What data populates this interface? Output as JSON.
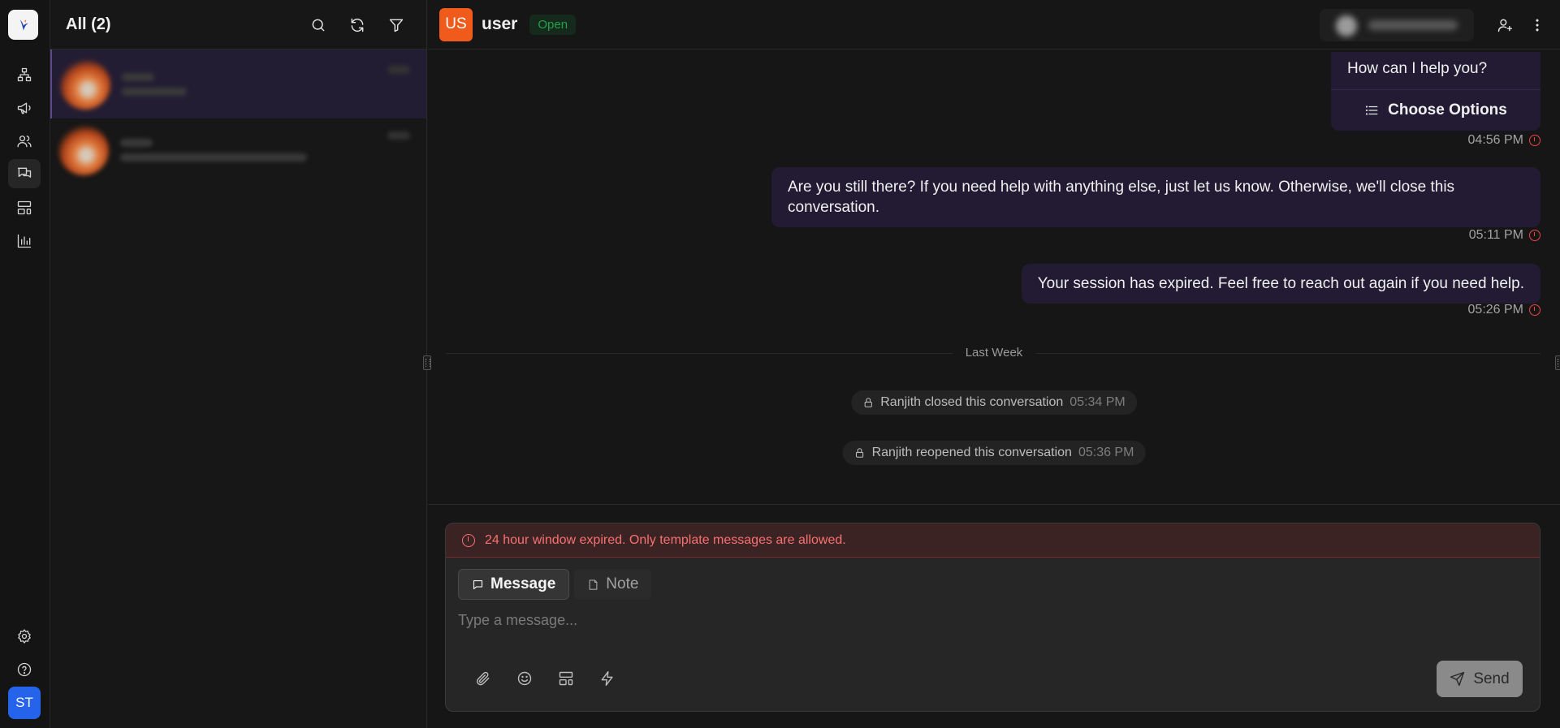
{
  "list": {
    "title": "All (2)"
  },
  "header": {
    "user_initials": "US",
    "user_name": "user",
    "status": "Open"
  },
  "messages": {
    "card_text": "How can I help you?",
    "card_button": "Choose Options",
    "card_time": "04:56 PM",
    "msg1_text": "Are you still there? If you need help with anything else, just let us know. Otherwise, we'll close this conversation.",
    "msg1_time": "05:11 PM",
    "msg2_text": "Your session has expired. Feel free to reach out again if you need help.",
    "msg2_time": "05:26 PM",
    "divider": "Last Week",
    "event1_text": "Ranjith closed this conversation",
    "event1_time": "05:34 PM",
    "event2_text": "Ranjith reopened this conversation",
    "event2_time": "05:36 PM"
  },
  "composer": {
    "warning": "24 hour window expired. Only template messages are allowed.",
    "tab_message": "Message",
    "tab_note": "Note",
    "placeholder": "Type a message...",
    "send": "Send"
  },
  "rail": {
    "user_initials": "ST"
  }
}
